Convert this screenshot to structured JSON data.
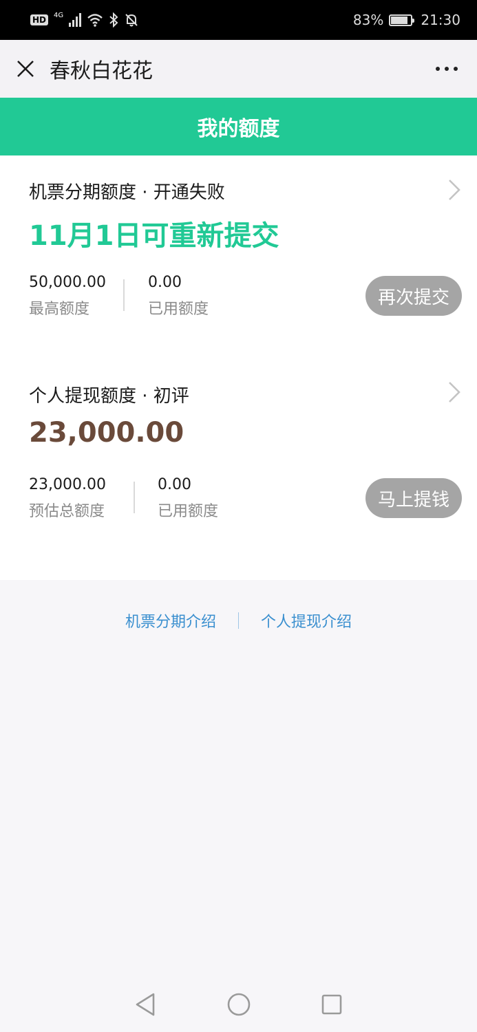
{
  "status_bar": {
    "hd": "HD",
    "network": "4G",
    "battery": "83%",
    "battery_fraction": 0.83,
    "time": "21:30"
  },
  "title_bar": {
    "title": "春秋白花花"
  },
  "header": {
    "title": "我的额度"
  },
  "cards": [
    {
      "title": "机票分期额度 · 开通失败",
      "status": "11月1日可重新提交",
      "status_color": "#21c995",
      "stat1_value": "50,000.00",
      "stat1_label": "最高额度",
      "stat2_value": "0.00",
      "stat2_label": "已用额度",
      "button": "再次提交"
    },
    {
      "title": "个人提现额度 · 初评",
      "status": "23,000.00",
      "status_color": "#6a4a3a",
      "stat1_value": "23,000.00",
      "stat1_label": "预估总额度",
      "stat2_value": "0.00",
      "stat2_label": "已用额度",
      "button": "马上提钱"
    }
  ],
  "links": {
    "left": "机票分期介绍",
    "right": "个人提现介绍"
  },
  "colors": {
    "accent": "#21c995",
    "button_gray": "#a5a5a5",
    "link": "#3a8fcf"
  }
}
